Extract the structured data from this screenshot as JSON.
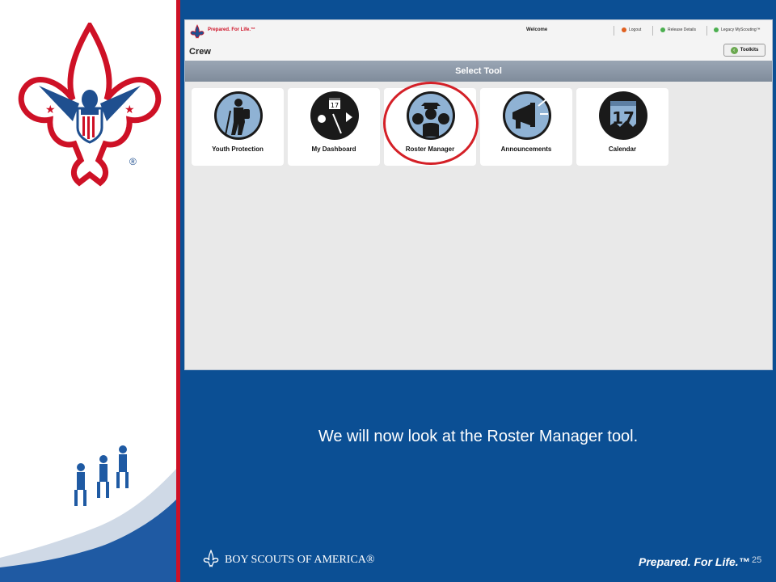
{
  "app": {
    "brand": "Prepared. For Life.™",
    "welcome": "Welcome",
    "nav": [
      "Logout",
      "Release Details",
      "Legacy MyScouting™"
    ],
    "unit": "Crew",
    "toolkits_label": "Toolkits",
    "select_tool_title": "Select Tool",
    "tools": [
      {
        "label": "Youth Protection",
        "icon": "hiker-icon"
      },
      {
        "label": "My Dashboard",
        "icon": "dashboard-icon"
      },
      {
        "label": "Roster Manager",
        "icon": "roster-icon"
      },
      {
        "label": "Announcements",
        "icon": "megaphone-icon"
      },
      {
        "label": "Calendar",
        "icon": "calendar-icon",
        "day": "17"
      }
    ],
    "dashboard_day": "17"
  },
  "slide": {
    "caption": "We will now look at the Roster Manager tool.",
    "page_number": "25",
    "org_name": "BOY SCOUTS OF AMERICA®",
    "tagline": "Prepared. For Life.™"
  },
  "colors": {
    "red": "#ce1126",
    "blue": "#0b4f94",
    "dark_blue": "#1f3b73"
  }
}
